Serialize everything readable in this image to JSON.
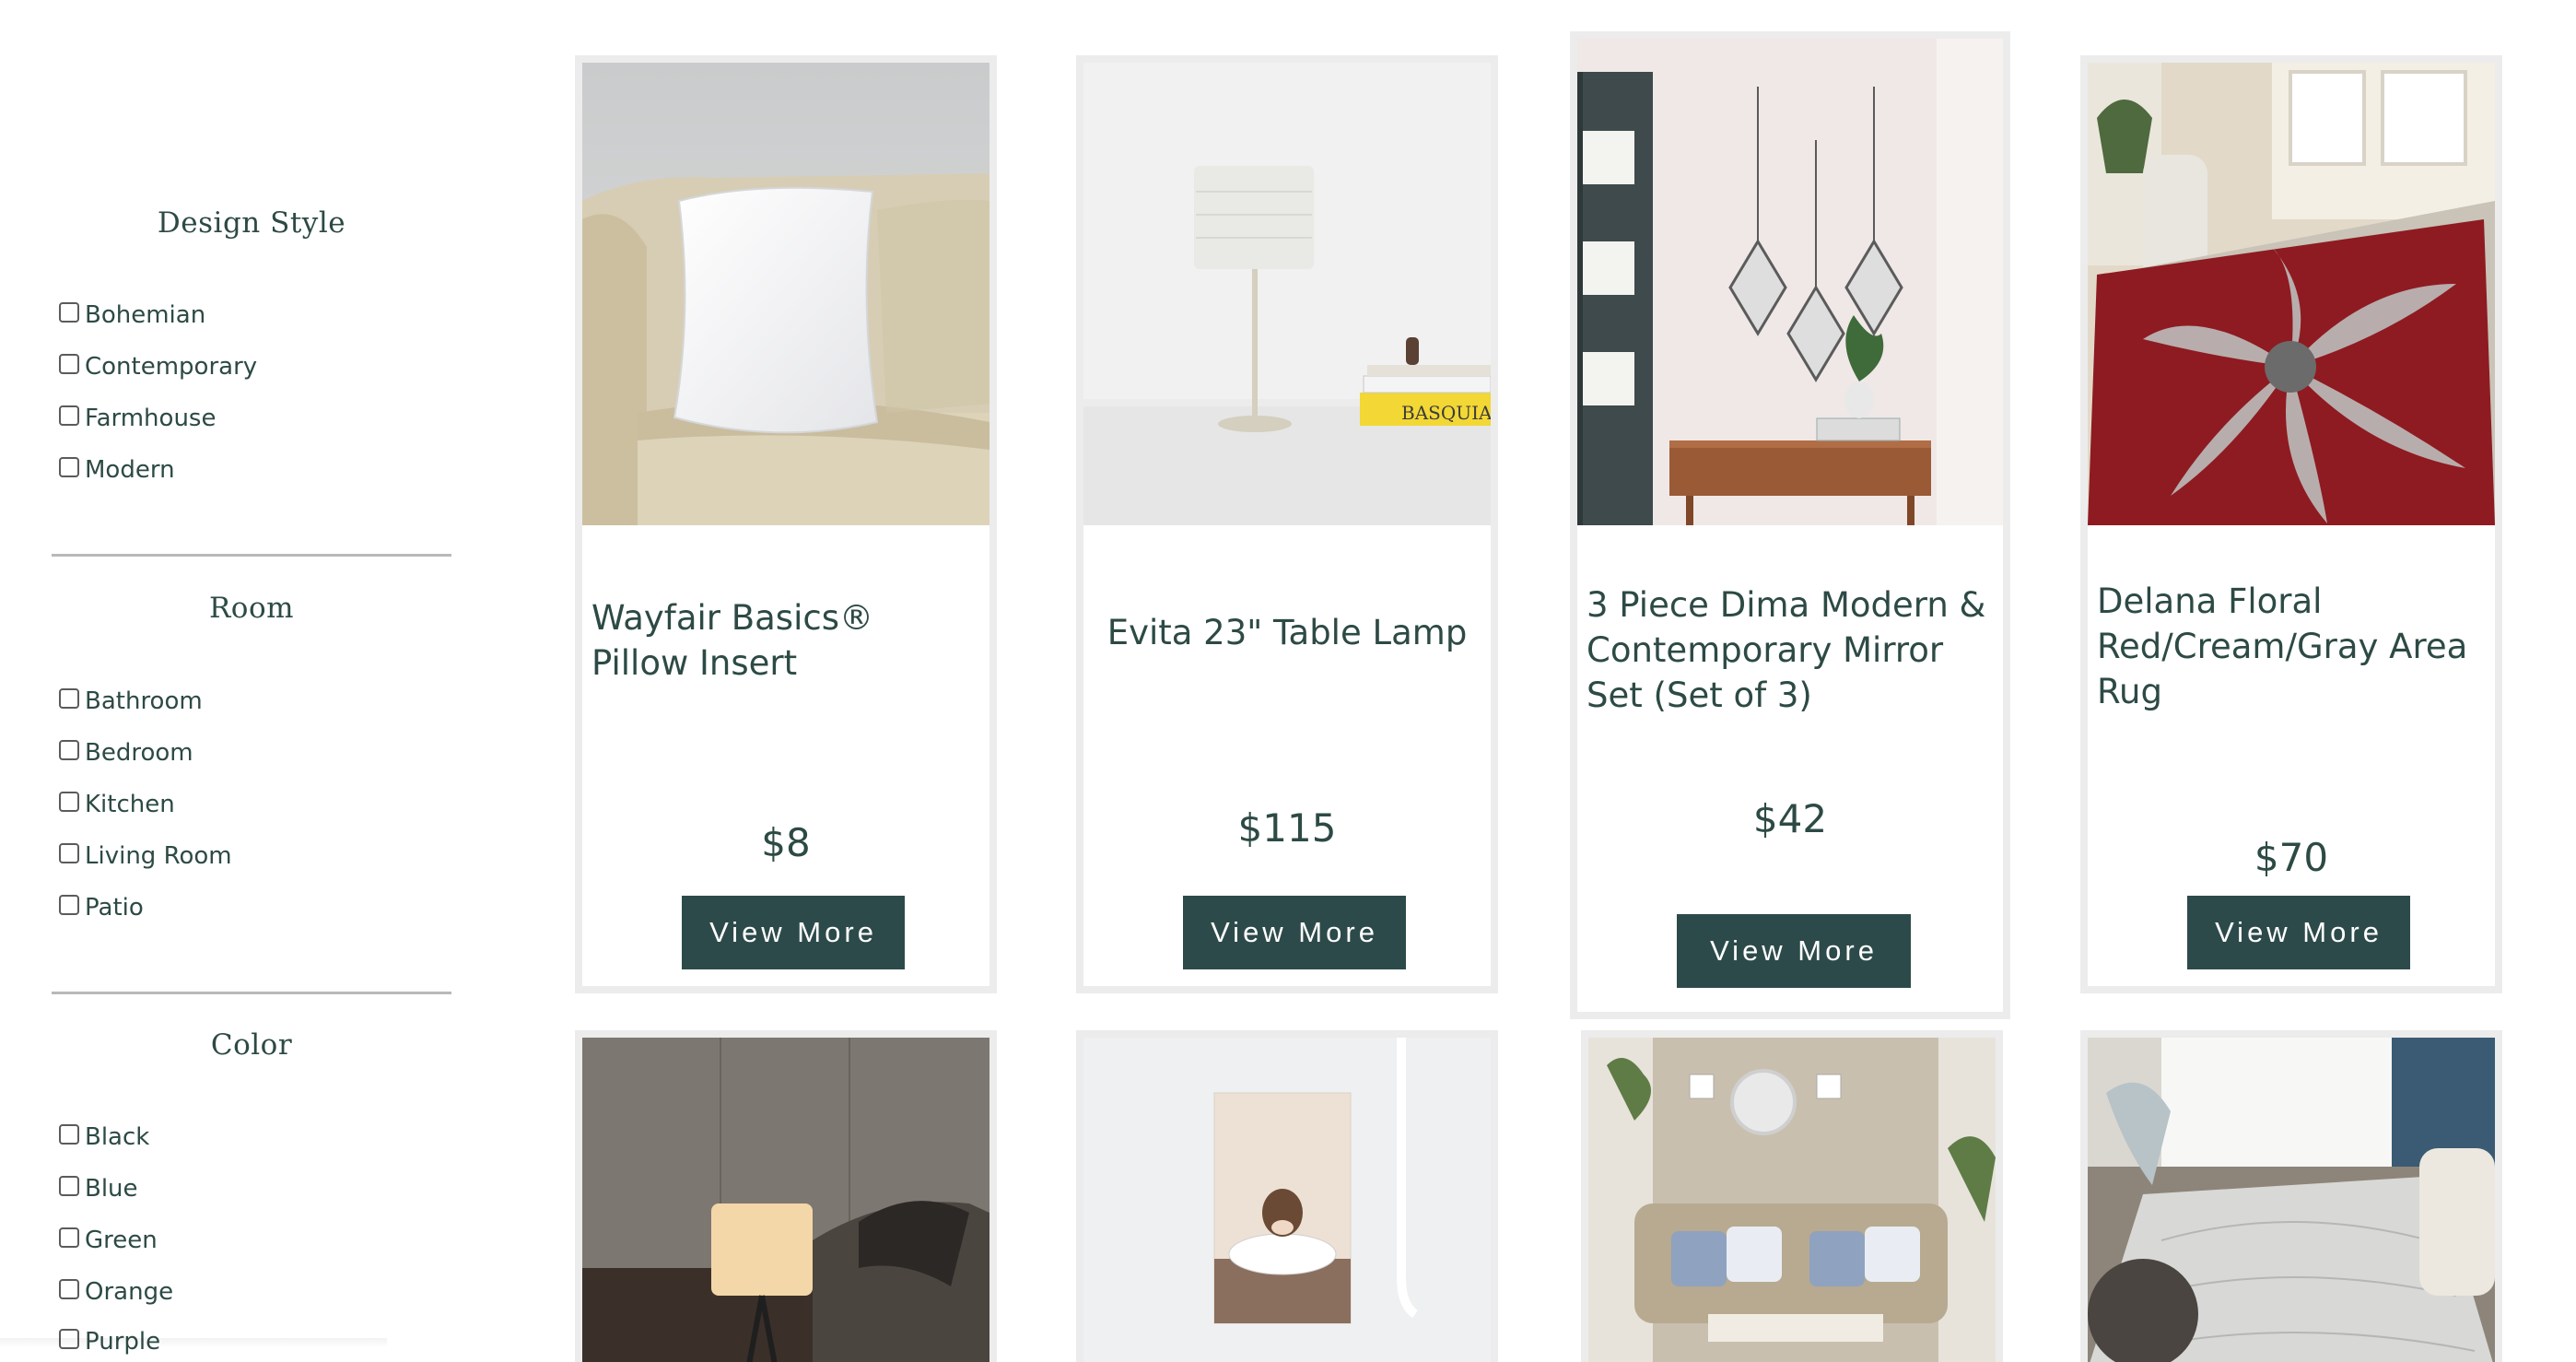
{
  "filters": {
    "design_style": {
      "title": "Design Style",
      "options": [
        "Bohemian",
        "Contemporary",
        "Farmhouse",
        "Modern"
      ]
    },
    "room": {
      "title": "Room",
      "options": [
        "Bathroom",
        "Bedroom",
        "Kitchen",
        "Living Room",
        "Patio"
      ]
    },
    "color": {
      "title": "Color",
      "options": [
        "Black",
        "Blue",
        "Green",
        "Orange",
        "Purple"
      ]
    }
  },
  "products": [
    {
      "name": "Wayfair Basics® Pillow Insert",
      "price": "$8",
      "button": "View More",
      "image_icon": "pillow-on-sofa-image"
    },
    {
      "name": "Evita 23\" Table Lamp",
      "price": "$115",
      "button": "View More",
      "image_icon": "table-lamp-image"
    },
    {
      "name": "3 Piece Dima Modern & Contemporary Mirror Set (Set of 3)",
      "price": "$42",
      "button": "View More",
      "image_icon": "mirror-set-image"
    },
    {
      "name": "Delana Floral Red/Cream/Gray Area Rug",
      "price": "$70",
      "button": "View More",
      "image_icon": "area-rug-image"
    }
  ],
  "second_row_images": [
    "floor-lamp-image",
    "cow-bathtub-art-image",
    "living-room-image",
    "gray-rug-image"
  ],
  "image_text": {
    "book_spine": "BASQUIAT"
  },
  "colors": {
    "primary": "#2d4a4a",
    "text": "#2d4a45",
    "card_border": "#ececec"
  }
}
